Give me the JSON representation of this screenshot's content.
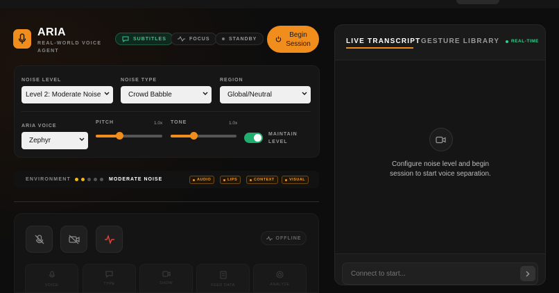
{
  "app": {
    "title": "ARIA",
    "subtitle": "REAL-WORLD VOICE AGENT"
  },
  "modes": [
    {
      "label": "SUBTITLES",
      "icon": "message-icon",
      "active": true
    },
    {
      "label": "FOCUS",
      "icon": "pulse-icon",
      "active": false
    },
    {
      "label": "STANDBY",
      "icon": "dot-icon",
      "active": false
    }
  ],
  "begin_button": {
    "label_line1": "Begin",
    "label_line2": "Session"
  },
  "controls": {
    "noise_level": {
      "label": "NOISE LEVEL",
      "value": "Level 2: Moderate Noise"
    },
    "noise_type": {
      "label": "NOISE TYPE",
      "value": "Crowd Babble"
    },
    "region": {
      "label": "REGION",
      "value": "Global/Neutral"
    },
    "aria_voice": {
      "label": "ARIA VOICE",
      "value": "Zephyr"
    },
    "pitch": {
      "label": "PITCH",
      "value_text": "1.0x",
      "fraction": 0.35
    },
    "tone": {
      "label": "TONE",
      "value_text": "1.0x",
      "fraction": 0.35
    },
    "maintain_level": {
      "label_line1": "MAINTAIN",
      "label_line2": "LEVEL",
      "on": true
    }
  },
  "environment": {
    "label": "ENVIRONMENT",
    "level": 2,
    "max": 5,
    "value": "MODERATE NOISE",
    "tags": [
      "AUDIO",
      "LIPS",
      "CONTEXT",
      "VISUAL"
    ]
  },
  "status": {
    "label": "OFFLINE"
  },
  "tools": [
    "VOICE",
    "TYPE",
    "SHOW",
    "FEED DATA",
    "ANALYZE"
  ],
  "right_panel": {
    "tab_active": "LIVE TRANSCRIPT",
    "tab_inactive": "GESTURE LIBRARY",
    "realtime": "REAL-TIME",
    "empty_message": "Configure noise level and begin session to start voice separation.",
    "input_placeholder": "Connect to start..."
  },
  "colors": {
    "accent": "#f08d1c",
    "green": "#2fd28a",
    "bg": "#0d0d0d"
  }
}
